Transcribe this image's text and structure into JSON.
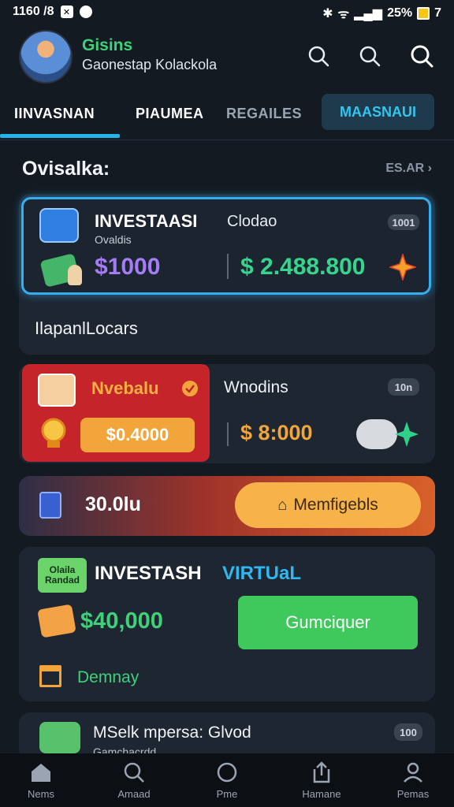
{
  "status_bar": {
    "time": "1160 /8",
    "battery": "25%",
    "extra": "7"
  },
  "header": {
    "app_name": "Gisins",
    "subtitle": "Gaonestap Kolackola"
  },
  "tabs": [
    {
      "label": "IINVASNAN"
    },
    {
      "label": "PIAUMEA"
    },
    {
      "label": "REGAILES"
    },
    {
      "label": "MAASNAUI"
    }
  ],
  "section": {
    "title": "Ovisalka:",
    "see_all": "ES.AR"
  },
  "card1": {
    "title": "INVESTAASI",
    "title2": "Clodao",
    "subtitle": "Ovaldis",
    "badge": "1001",
    "amount_left": "$1000",
    "amount_right": "$ 2.488.800",
    "footer": "IlapanlLocars"
  },
  "card2": {
    "label": "Nvebalu",
    "amount_btn": "$0.4000",
    "title": "Wnodins",
    "badge": "10n",
    "amount": "$ 8:000"
  },
  "banner": {
    "amount": "30.0lu",
    "button": "Memfigebls"
  },
  "card3": {
    "tag_line1": "Olaila",
    "tag_line2": "Randad",
    "title": "INVESTASH",
    "title_accent": "VIRTUaL",
    "amount": "$40,000",
    "button": "Gumciquer",
    "footer": "Demnay"
  },
  "card4": {
    "title": "MSelk mpersa: Glvod",
    "subtitle": "Gamchacrdd",
    "badge": "100"
  },
  "nav": [
    {
      "label": "Nems",
      "icon": "home-icon"
    },
    {
      "label": "Amaad",
      "icon": "search-icon"
    },
    {
      "label": "Pme",
      "icon": "circle-icon"
    },
    {
      "label": "Hamane",
      "icon": "share-icon"
    },
    {
      "label": "Pemas",
      "icon": "profile-icon"
    }
  ],
  "colors": {
    "background": "#141a22",
    "accent_blue": "#22b5e8",
    "accent_green": "#3fd07a",
    "purple": "#a57cf5",
    "orange": "#f2a53a",
    "red_card": "#c4242a"
  }
}
